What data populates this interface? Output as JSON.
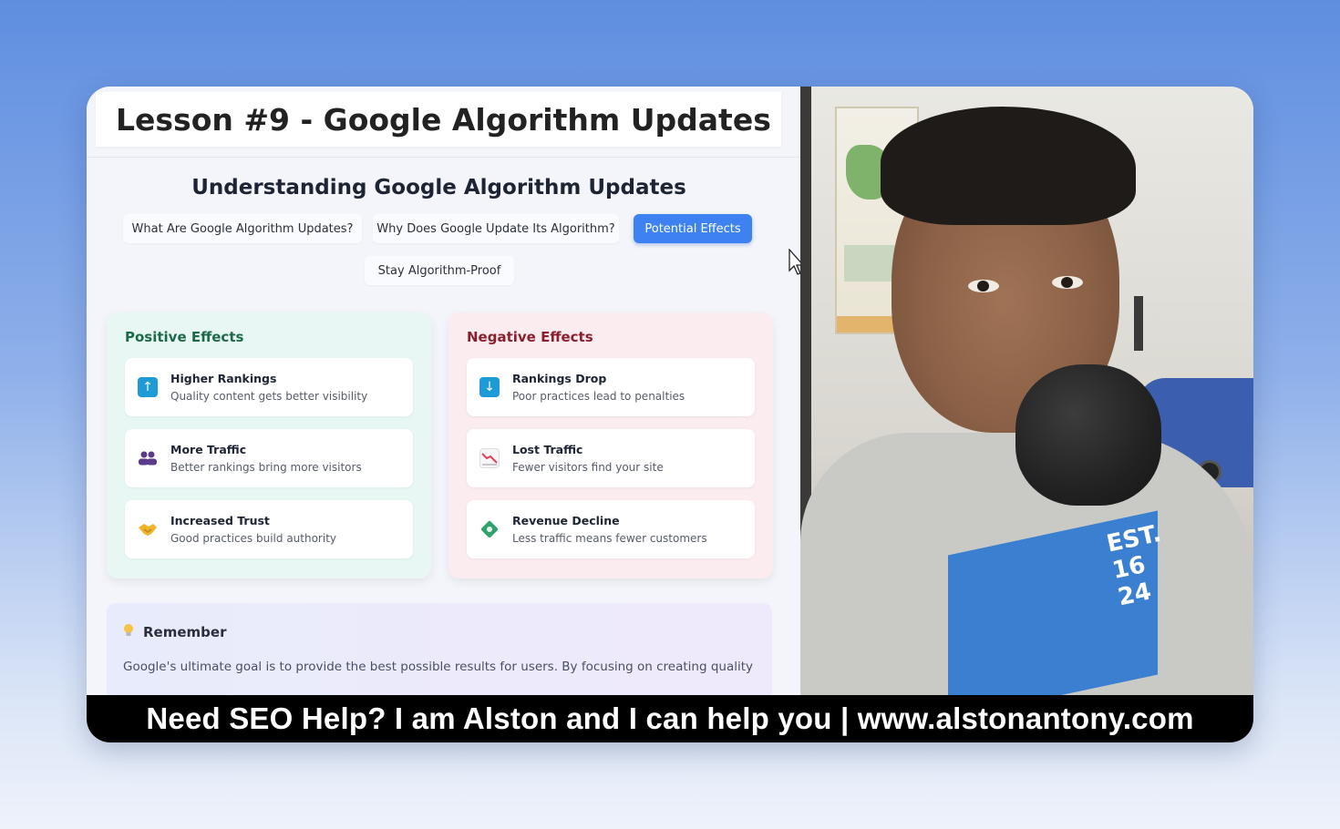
{
  "lesson": {
    "title": "Lesson #9 - Google Algorithm Updates"
  },
  "slide": {
    "heading": "Understanding Google Algorithm Updates",
    "tabs": [
      {
        "label": "What Are Google Algorithm Updates?",
        "active": false
      },
      {
        "label": "Why Does Google Update Its Algorithm?",
        "active": false
      },
      {
        "label": "Potential Effects",
        "active": true
      },
      {
        "label": "Stay Algorithm-Proof",
        "active": false
      }
    ],
    "positive": {
      "title": "Positive Effects",
      "items": [
        {
          "icon": "arrow-up-icon",
          "title": "Higher Rankings",
          "desc": "Quality content gets better visibility"
        },
        {
          "icon": "people-icon",
          "title": "More Traffic",
          "desc": "Better rankings bring more visitors"
        },
        {
          "icon": "handshake-icon",
          "title": "Increased Trust",
          "desc": "Good practices build authority"
        }
      ]
    },
    "negative": {
      "title": "Negative Effects",
      "items": [
        {
          "icon": "arrow-down-icon",
          "title": "Rankings Drop",
          "desc": "Poor practices lead to penalties"
        },
        {
          "icon": "chart-down-icon",
          "title": "Lost Traffic",
          "desc": "Fewer visitors find your site"
        },
        {
          "icon": "money-icon",
          "title": "Revenue Decline",
          "desc": "Less traffic means fewer customers"
        }
      ]
    },
    "remember": {
      "title": "Remember",
      "text": "Google's ultimate goal is to provide the best possible results for users. By focusing on creating quality"
    }
  },
  "video": {
    "shirt_text": "EST. 16 24"
  },
  "banner": {
    "text": "Need SEO Help? I am Alston and I can help you | www.alstonantony.com"
  },
  "colors": {
    "accent": "#3d82f0",
    "positive_title": "#1c6a4a",
    "negative_title": "#8a1f2e"
  }
}
